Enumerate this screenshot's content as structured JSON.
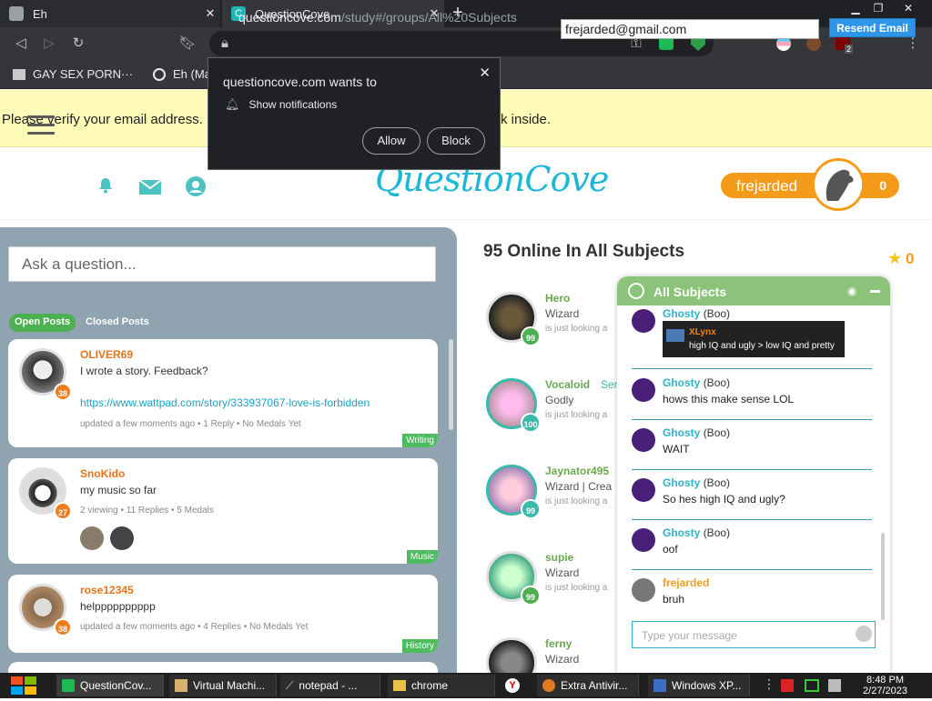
{
  "browser": {
    "tabs": [
      {
        "label": "Eh",
        "close": "✕"
      },
      {
        "label": "QuestionCove",
        "close": "✕"
      }
    ],
    "new_tab": "+",
    "window_controls": [
      "▁",
      "❐",
      "✕"
    ],
    "url_host": "questioncove.com",
    "url_path": "/study#/groups/All%20Subjects",
    "bookmarks": [
      {
        "label": "GAY SEX PORN···"
      },
      {
        "label": "Eh (Ma"
      }
    ],
    "extension_badge": "2"
  },
  "notification_popup": {
    "title": "questioncove.com wants to",
    "item": "Show notifications",
    "allow_label": "Allow",
    "block_label": "Block",
    "close": "✕"
  },
  "banner": {
    "text_left": "Please verify your email address.",
    "text_right": "k inside.",
    "email_value": "frejarded@gmail.com",
    "resend_label": "Resend Email"
  },
  "header": {
    "logo_text": "QuestionCove",
    "username": "frejarded",
    "points": "0"
  },
  "feed": {
    "ask_placeholder": "Ask a question...",
    "filter_open": "Open Posts",
    "filter_closed": "Closed Posts",
    "posts": [
      {
        "user": "OLIVER69",
        "level": "38",
        "text": "I wrote a story. Feedback?",
        "link": "https://www.wattpad.com/story/333937067-love-is-forbidden",
        "meta": "updated a few moments ago   •   1 Reply   •   No Medals Yet",
        "tag": "Writing"
      },
      {
        "user": "SnoKido",
        "level": "27",
        "text": "my music so far",
        "meta": "2 viewing   •   11 Replies   •   5 Medals",
        "tag": "Music"
      },
      {
        "user": "rose12345",
        "level": "38",
        "text": "helpppppppppp",
        "meta": "updated a few moments ago   •   4 Replies   •   No Medals Yet",
        "tag": "History"
      }
    ]
  },
  "online": {
    "title": "95 Online In All Subjects",
    "count": "0",
    "users": [
      {
        "name": "Hero",
        "rank": "Wizard",
        "status": "is just looking a",
        "level": "99"
      },
      {
        "name": "Vocaloid",
        "extra": "Ser",
        "rank": "Godly",
        "status": "is just looking a",
        "level": "100"
      },
      {
        "name": "Jaynator495",
        "rank": "Wizard | Crea",
        "status": "is just looking a",
        "level": "99"
      },
      {
        "name": "supie",
        "rank": "Wizard",
        "status": "is just looking a",
        "level": "99"
      },
      {
        "name": "ferny",
        "rank": "Wizard",
        "status": "",
        "level": ""
      }
    ]
  },
  "chat": {
    "title": "All Subjects",
    "quote": {
      "user": "XLynx",
      "text": "high IQ and ugly > low IQ and pretty"
    },
    "messages": [
      {
        "user": "Ghosty",
        "tag": "(Boo)",
        "text": ""
      },
      {
        "user": "Ghosty",
        "tag": "(Boo)",
        "text": "hows this make sense LOL"
      },
      {
        "user": "Ghosty",
        "tag": "(Boo)",
        "text": "WAIT"
      },
      {
        "user": "Ghosty",
        "tag": "(Boo)",
        "text": "So hes high IQ and ugly?"
      },
      {
        "user": "Ghosty",
        "tag": "(Boo)",
        "text": "oof"
      },
      {
        "user": "frejarded",
        "tag": "",
        "text": "bruh"
      }
    ],
    "input_placeholder": "Type your message"
  },
  "taskbar": {
    "items": [
      "QuestionCov...",
      "Virtual Machi...",
      "notepad - ...",
      "chrome",
      "Extra Antivir...",
      "Windows XP..."
    ],
    "time": "8:48 PM",
    "date": "2/27/2023"
  }
}
